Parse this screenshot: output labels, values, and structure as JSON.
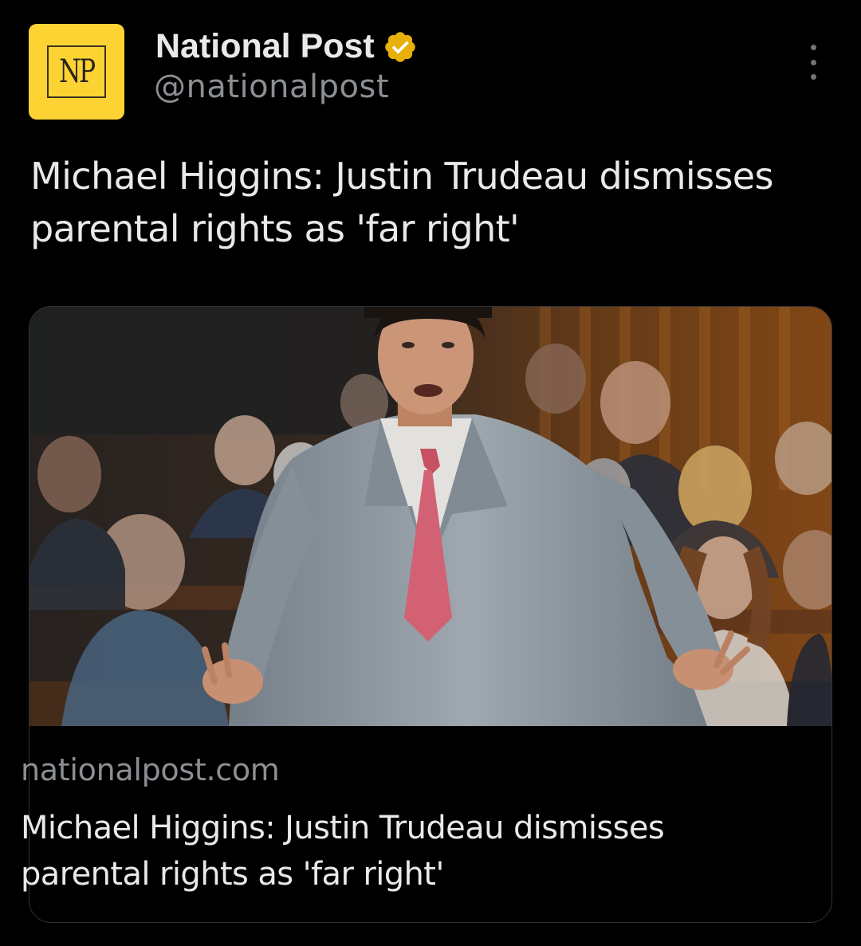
{
  "account": {
    "display_name": "National Post",
    "handle": "@nationalpost",
    "avatar_text": "NP",
    "verified": true,
    "verified_icon": "verified-badge-icon",
    "verified_color": "#e8b00a",
    "avatar_color": "#fdd334"
  },
  "more_icon": "more-options-icon",
  "tweet": {
    "text": "Michael Higgins: Justin Trudeau dismisses parental rights as 'far right'"
  },
  "card": {
    "image_icon": "article-photo",
    "domain": "nationalpost.com",
    "title": "Michael Higgins: Justin Trudeau dismisses parental rights as 'far right'"
  }
}
